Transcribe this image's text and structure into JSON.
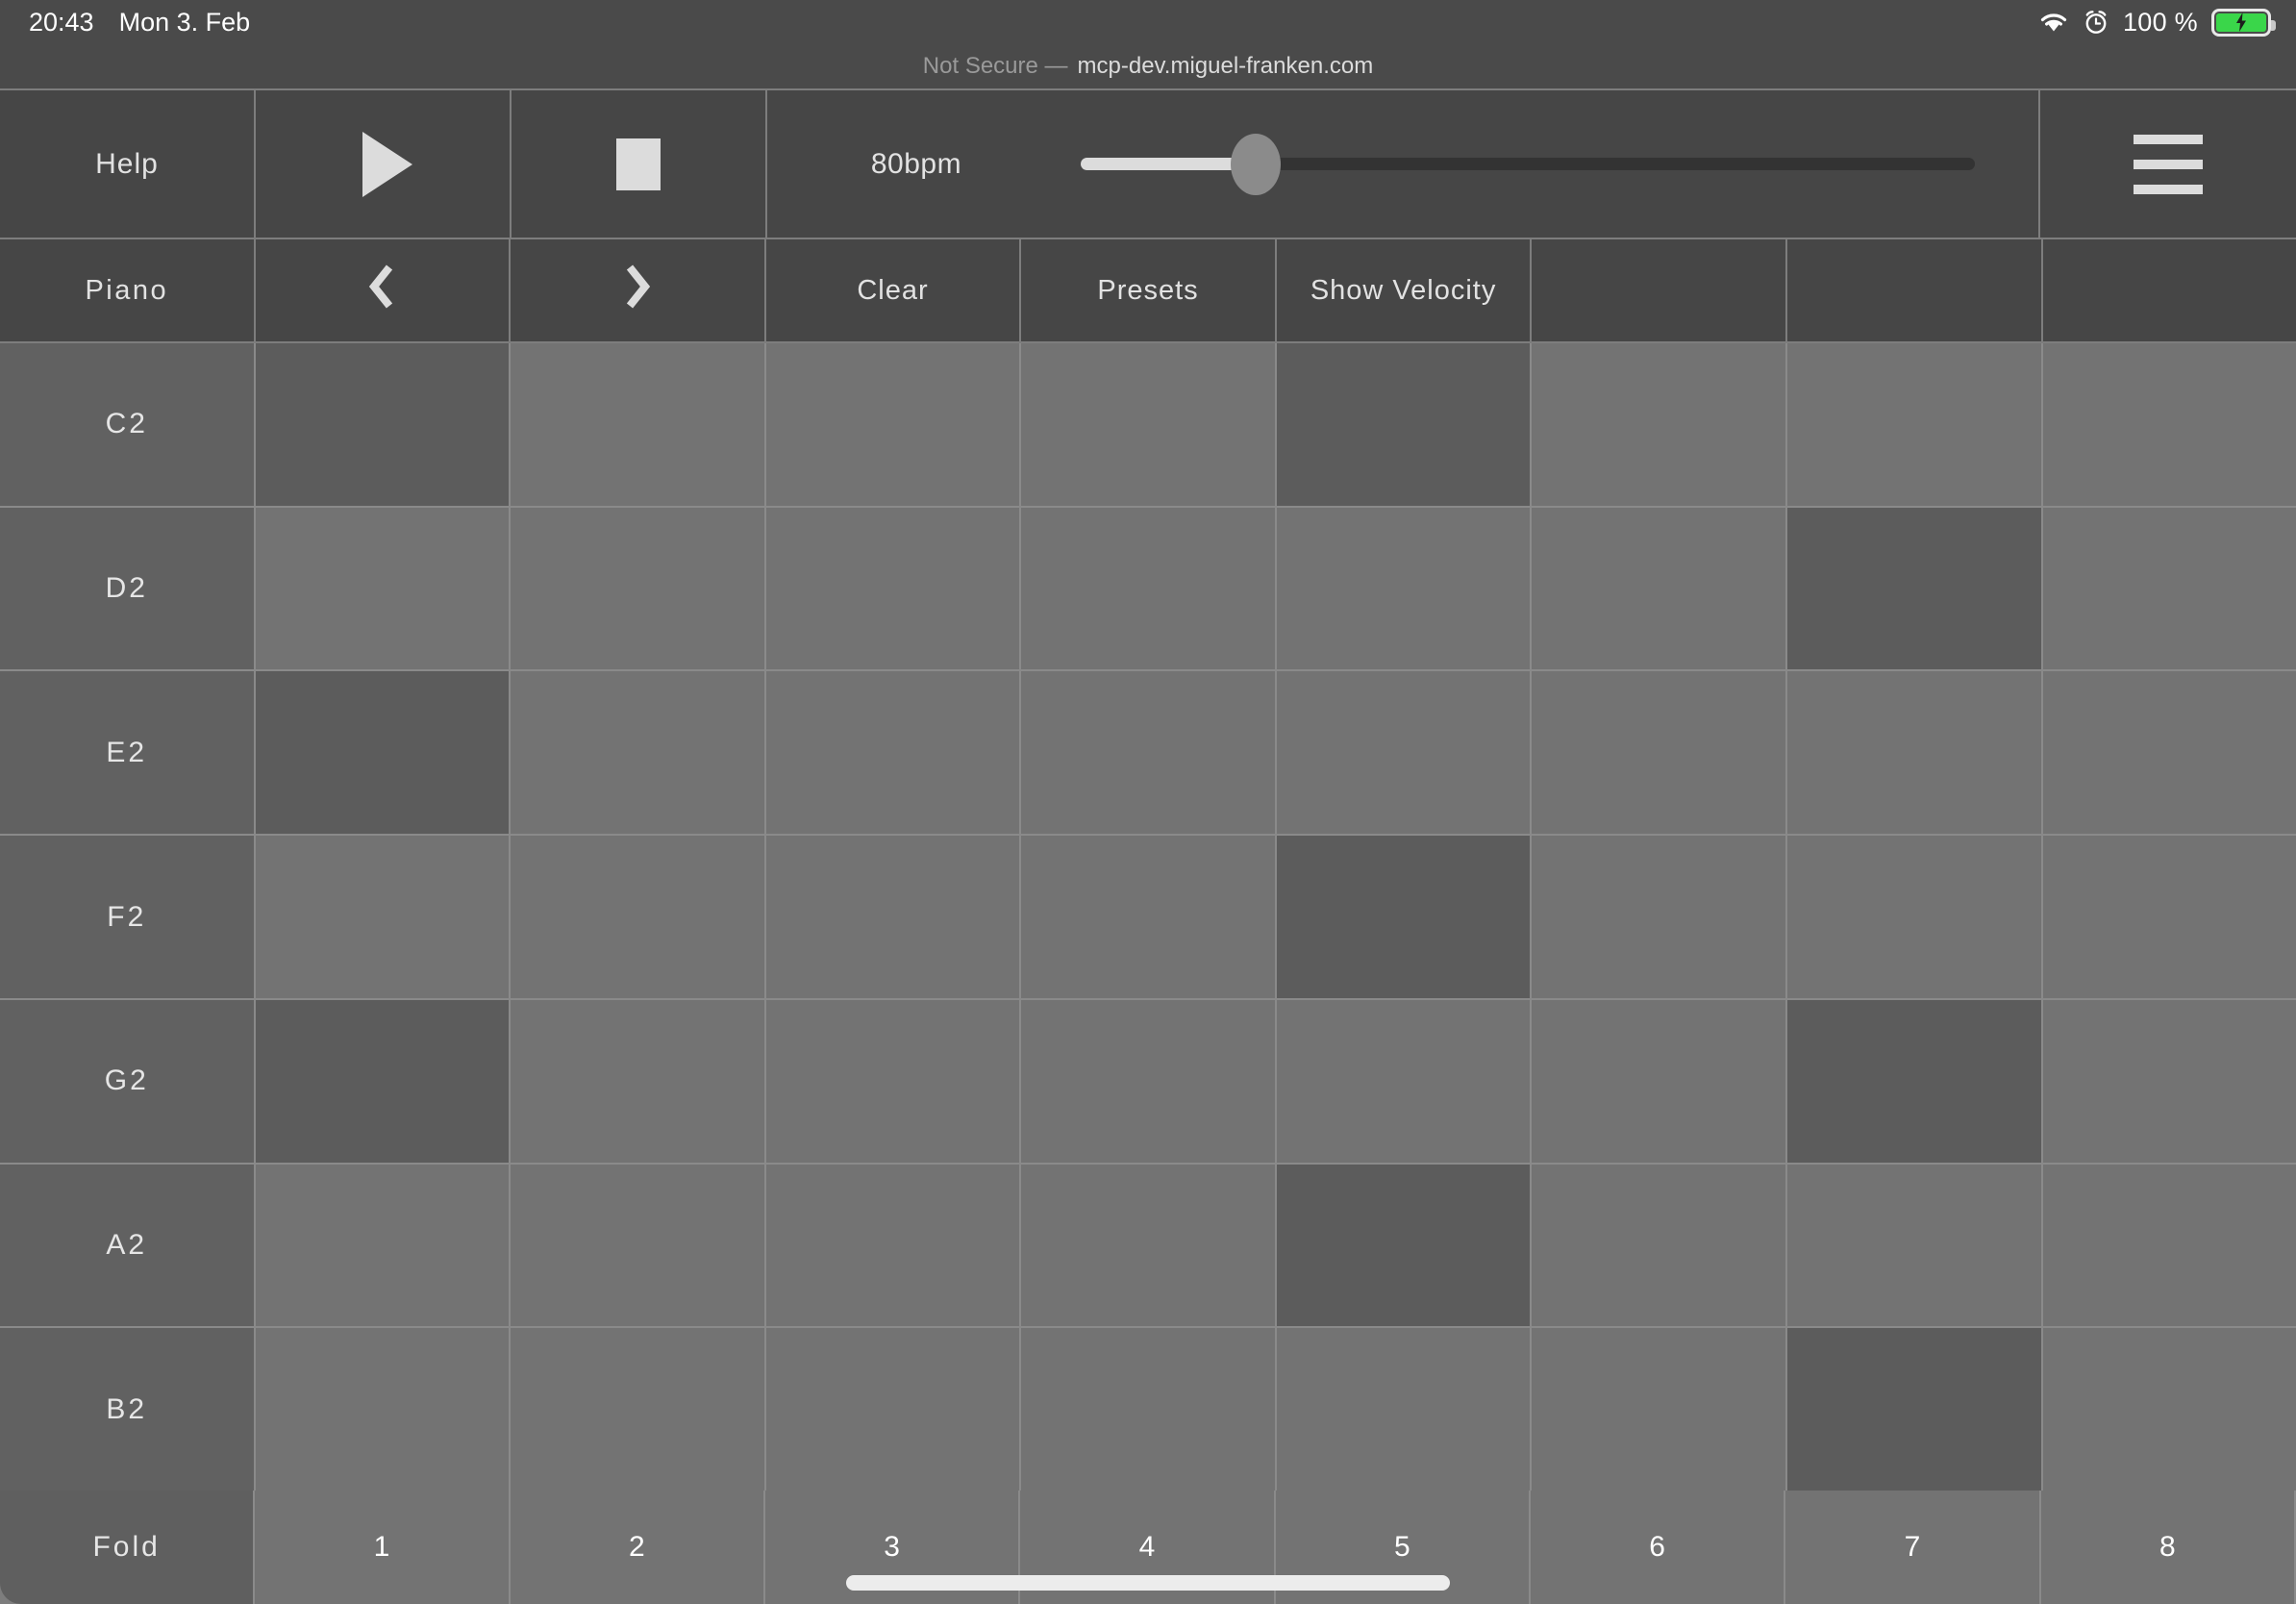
{
  "status_bar": {
    "time": "20:43",
    "date": "Mon 3. Feb",
    "battery_percent": "100 %",
    "wifi_icon": "wifi-icon",
    "alarm_icon": "alarm-clock-icon",
    "battery_icon": "battery-charging-icon",
    "battery_color": "#3ad64a"
  },
  "browser_bar": {
    "security_label": "Not Secure —",
    "host": "mcp-dev.miguel-franken.com"
  },
  "transport": {
    "help_label": "Help",
    "play_icon": "play-icon",
    "stop_icon": "stop-icon",
    "tempo_label": "80bpm",
    "tempo_value": 80,
    "menu_icon": "hamburger-menu-icon"
  },
  "toolbar": {
    "instrument_label": "Piano",
    "prev_icon": "chevron-left-icon",
    "next_icon": "chevron-right-icon",
    "clear_label": "Clear",
    "presets_label": "Presets",
    "show_velocity_label": "Show Velocity",
    "empty_1": "",
    "empty_2": "",
    "empty_3": ""
  },
  "sequencer": {
    "fold_label": "Fold",
    "steps": [
      "1",
      "2",
      "3",
      "4",
      "5",
      "6",
      "7",
      "8"
    ],
    "rows": [
      {
        "note": "C2",
        "cells": [
          1,
          0,
          0,
          0,
          1,
          0,
          0,
          0
        ]
      },
      {
        "note": "D2",
        "cells": [
          0,
          0,
          0,
          0,
          0,
          0,
          1,
          0
        ]
      },
      {
        "note": "E2",
        "cells": [
          1,
          0,
          0,
          0,
          0,
          0,
          0,
          0
        ]
      },
      {
        "note": "F2",
        "cells": [
          0,
          0,
          0,
          0,
          1,
          0,
          0,
          0
        ]
      },
      {
        "note": "G2",
        "cells": [
          1,
          0,
          0,
          0,
          0,
          0,
          1,
          0
        ]
      },
      {
        "note": "A2",
        "cells": [
          0,
          0,
          0,
          0,
          1,
          0,
          0,
          0
        ]
      },
      {
        "note": "B2",
        "cells": [
          0,
          0,
          0,
          0,
          0,
          0,
          1,
          0
        ]
      }
    ]
  },
  "colors": {
    "chrome_bg": "#4a4a4a",
    "button_bg": "#464646",
    "cell_off": "#737373",
    "cell_on": "#5c5c5c",
    "row_label_bg": "#616161",
    "gridline": "#8a8a8a",
    "text": "#e2e2e2"
  }
}
